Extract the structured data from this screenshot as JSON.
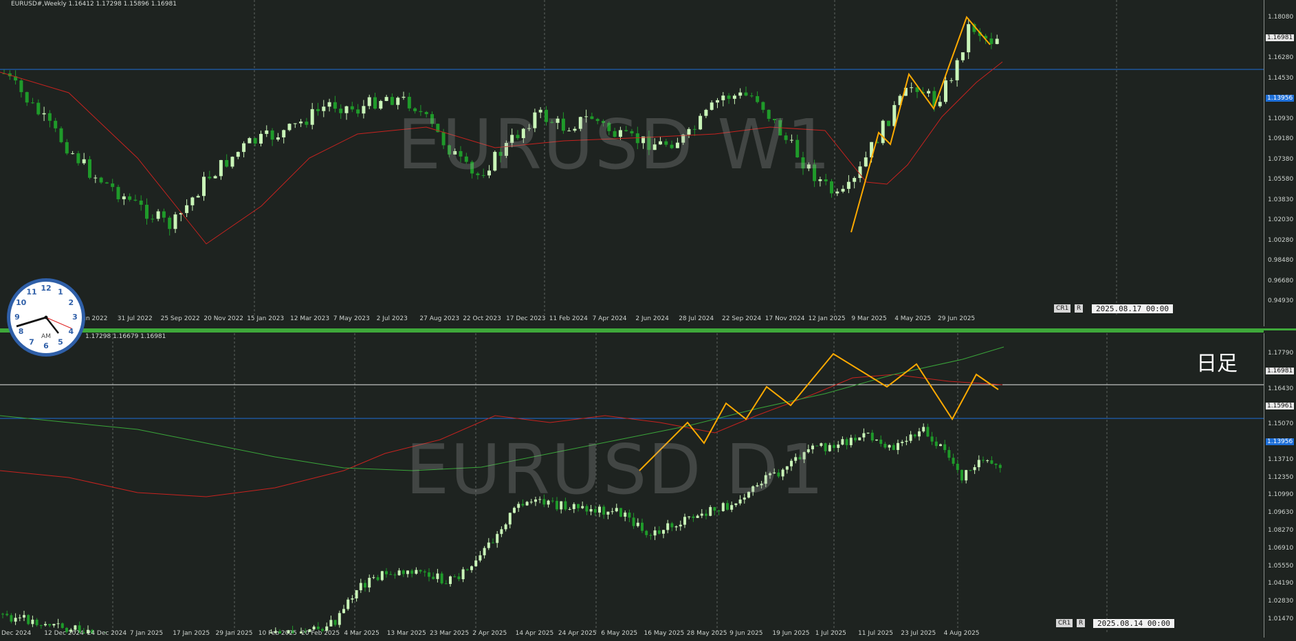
{
  "top_chart": {
    "header": "EURUSD#,Weekly  1.16412 1.17298 1.15896 1.16981",
    "watermark": "EURUSD W1",
    "price_labels": [
      "1.18080",
      "1.16981",
      "1.16280",
      "1.14530",
      "1.13956",
      "1.10930",
      "1.09180",
      "1.07380",
      "1.05580",
      "1.03830",
      "1.02030",
      "1.00280",
      "0.98480",
      "0.96680",
      "0.94930"
    ],
    "current_price": "1.16981",
    "hline_price": "1.13956",
    "x_labels": [
      "5 Jun 2022",
      "31 Jul 2022",
      "25 Sep 2022",
      "20 Nov 2022",
      "15 Jan 2023",
      "12 Mar 2023",
      "7 May 2023",
      "2 Jul 2023",
      "27 Aug 2023",
      "22 Oct 2023",
      "17 Dec 2023",
      "11 Feb 2024",
      "7 Apr 2024",
      "2 Jun 2024",
      "28 Jul 2024",
      "22 Sep 2024",
      "17 Nov 2024",
      "12 Jan 2025",
      "9 Mar 2025",
      "4 May 2025",
      "29 Jun 2025"
    ],
    "cr_label": "CR1",
    "r_label": "R",
    "date_label": "2025.08.17 00:00"
  },
  "bottom_chart": {
    "header": "1.17298 1.16679 1.16981",
    "watermark": "EURUSD D1",
    "jp_label": "日足",
    "price_labels": [
      "1.17790",
      "1.16981",
      "1.16430",
      "1.15961",
      "1.15070",
      "1.13956",
      "1.13710",
      "1.12350",
      "1.10990",
      "1.09630",
      "1.08270",
      "1.06910",
      "1.05550",
      "1.04190",
      "1.02830",
      "1.01470"
    ],
    "current_price": "1.16981",
    "white_line_price": "1.15961",
    "blue_line_price": "1.13956",
    "x_labels": [
      "Dec 2024",
      "12 Dec 2024",
      "24 Dec 2024",
      "7 Jan 2025",
      "17 Jan 2025",
      "29 Jan 2025",
      "10 Feb 2025",
      "20 Feb 2025",
      "4 Mar 2025",
      "13 Mar 2025",
      "23 Mar 2025",
      "2 Apr 2025",
      "14 Apr 2025",
      "24 Apr 2025",
      "6 May 2025",
      "16 May 2025",
      "28 May 2025",
      "9 Jun 2025",
      "19 Jun 2025",
      "1 Jul 2025",
      "11 Jul 2025",
      "23 Jul 2025",
      "4 Aug 2025"
    ],
    "cr_label": "CR1",
    "r_label": "R",
    "date_label": "2025.08.14 00:00"
  },
  "clock": {
    "numbers": [
      "12",
      "1",
      "2",
      "3",
      "4",
      "5",
      "6",
      "7",
      "8",
      "9",
      "10",
      "11"
    ],
    "ampm": "AM"
  },
  "colors": {
    "background": "#1e2320",
    "bull": "#c9f5b8",
    "bear": "#1f9a2a",
    "ma_red": "#c8231f",
    "ma_green": "#3aa63a",
    "zigzag": "#ffaa00",
    "hline_blue": "#1e6fd8",
    "hline_white": "#e8e8e8"
  }
}
